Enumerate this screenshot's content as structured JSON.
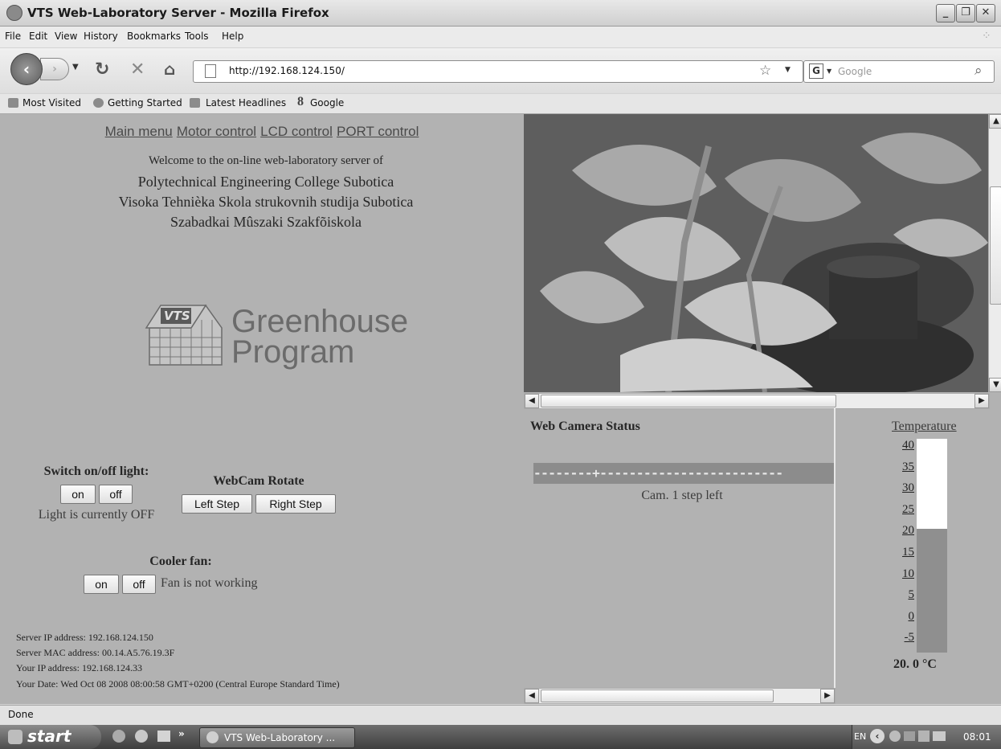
{
  "window": {
    "title": "VTS Web-Laboratory Server - Mozilla Firefox"
  },
  "menubar": {
    "items": [
      "File",
      "Edit",
      "View",
      "History",
      "Bookmarks",
      "Tools",
      "Help"
    ]
  },
  "navbar": {
    "url": "http://192.168.124.150/",
    "search_placeholder": "Google"
  },
  "bookmarks": {
    "items": [
      "Most Visited",
      "Getting Started",
      "Latest Headlines",
      "Google"
    ]
  },
  "page": {
    "nav_links": [
      "Main menu",
      "Motor control",
      "LCD control",
      "PORT control"
    ],
    "welcome": {
      "line1": "Welcome to the on-line web-laboratory server of",
      "line2": "Polytechnical Engineering College Subotica",
      "line3": "Visoka Tehnièka Skola strukovnih studija Subotica",
      "line4": "Szabadkai Mûszaki Szakfõiskola"
    },
    "logo": {
      "badge": "VTS",
      "line1": "Greenhouse",
      "line2": "Program"
    },
    "light": {
      "heading": "Switch on/off light:",
      "on": "on",
      "off": "off",
      "status": "Light is currently OFF"
    },
    "webcam": {
      "heading": "WebCam Rotate",
      "left": "Left Step",
      "right": "Right Step"
    },
    "fan": {
      "heading": "Cooler fan:",
      "on": "on",
      "off": "off",
      "status": "Fan is not working"
    },
    "server_info": {
      "ip": "Server IP address: 192.168.124.150",
      "mac": "Server MAC address: 00.14.A5.76.19.3F",
      "your_ip": "Your IP address: 192.168.124.33",
      "date": "Your Date: Wed Oct 08 2008 08:00:58 GMT+0200 (Central Europe Standard Time)"
    },
    "camera_status": {
      "title": "Web Camera Status",
      "position_bar": "--------+-------------------------",
      "message": "Cam. 1 step left"
    },
    "temperature": {
      "title": "Temperature",
      "scale": [
        "40",
        "35",
        "30",
        "25",
        "20",
        "15",
        "10",
        "5",
        "0",
        "-5"
      ],
      "reading": "20. 0 °C",
      "value_c": 20,
      "scale_min_c": -5,
      "scale_max_c": 40
    }
  },
  "statusbar": {
    "text": "Done"
  },
  "taskbar": {
    "start_label": "start",
    "task": "VTS Web-Laboratory ...",
    "lang": "EN",
    "clock": "08:01"
  }
}
